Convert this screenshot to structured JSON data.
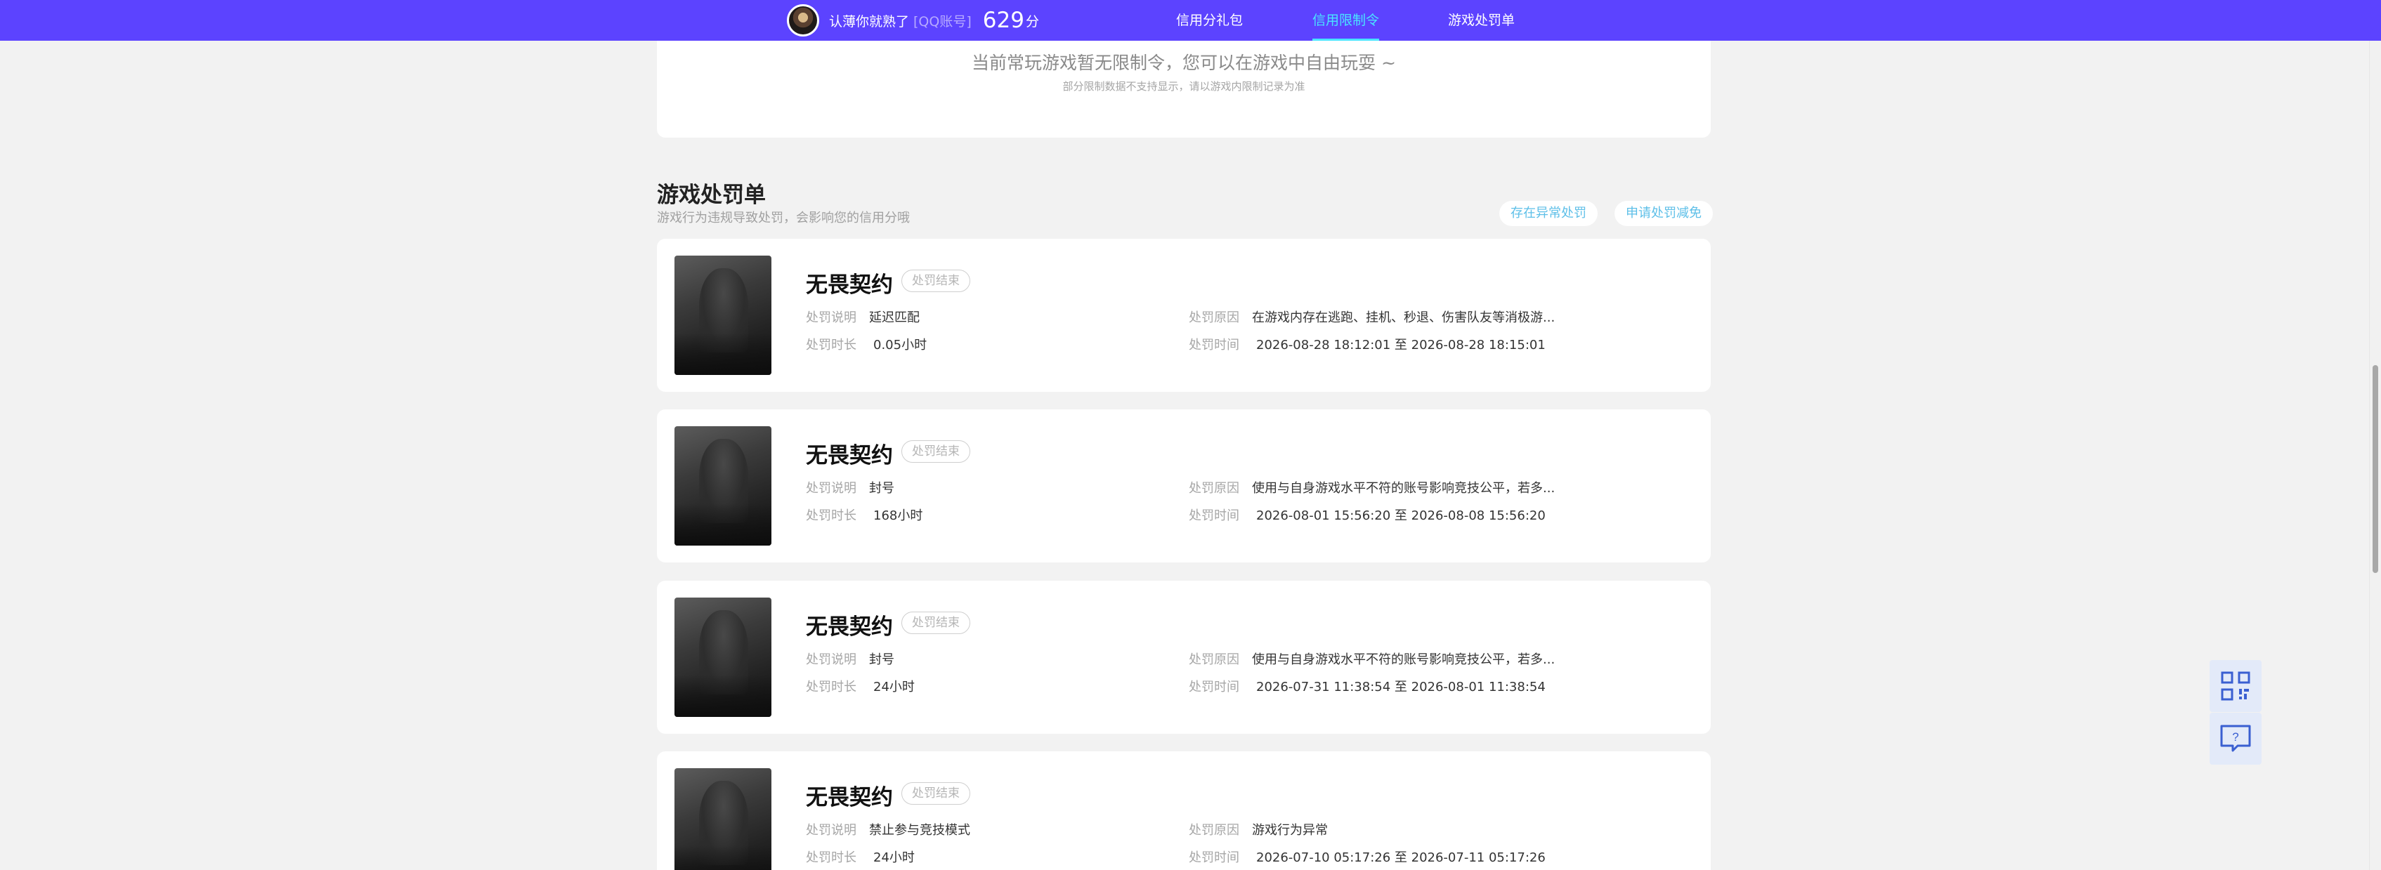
{
  "header": {
    "username": "认薄你就熟了",
    "account_type": "[QQ账号]",
    "score": "629",
    "score_unit": "分",
    "nav": [
      {
        "label": "信用分礼包",
        "active": false
      },
      {
        "label": "信用限制令",
        "active": true
      },
      {
        "label": "游戏处罚单",
        "active": false
      }
    ]
  },
  "restriction": {
    "message": "当前常玩游戏暂无限制令，您可以在游戏中自由玩耍 ~",
    "note": "部分限制数据不支持显示，请以游戏内限制记录为准"
  },
  "penalty_section": {
    "title": "游戏处罚单",
    "subtitle": "游戏行为违规导致处罚，会影响您的信用分哦",
    "appeal_button": "存在异常处罚",
    "reduce_button": "申请处罚减免"
  },
  "labels": {
    "desc": "处罚说明",
    "duration": "处罚时长",
    "reason": "处罚原因",
    "time": "处罚时间"
  },
  "penalties": [
    {
      "game": "无畏契约",
      "status": "处罚结束",
      "desc": "延迟匹配",
      "duration": "0.05小时",
      "reason": "在游戏内存在逃跑、挂机、秒退、伤害队友等消极游...",
      "time": "2026-08-28 18:12:01 至 2026-08-28 18:15:01"
    },
    {
      "game": "无畏契约",
      "status": "处罚结束",
      "desc": "封号",
      "duration": "168小时",
      "reason": "使用与自身游戏水平不符的账号影响竞技公平，若多...",
      "time": "2026-08-01 15:56:20 至 2026-08-08 15:56:20"
    },
    {
      "game": "无畏契约",
      "status": "处罚结束",
      "desc": "封号",
      "duration": "24小时",
      "reason": "使用与自身游戏水平不符的账号影响竞技公平，若多...",
      "time": "2026-07-31 11:38:54 至 2026-08-01 11:38:54"
    },
    {
      "game": "无畏契约",
      "status": "处罚结束",
      "desc": "禁止参与竞技模式",
      "duration": "24小时",
      "reason": "游戏行为异常",
      "time": "2026-07-10 05:17:26 至 2026-07-11 05:17:26"
    }
  ],
  "side_tools": [
    {
      "icon": "qrcode-icon"
    },
    {
      "icon": "help-chat-icon",
      "glyph": "?"
    }
  ]
}
